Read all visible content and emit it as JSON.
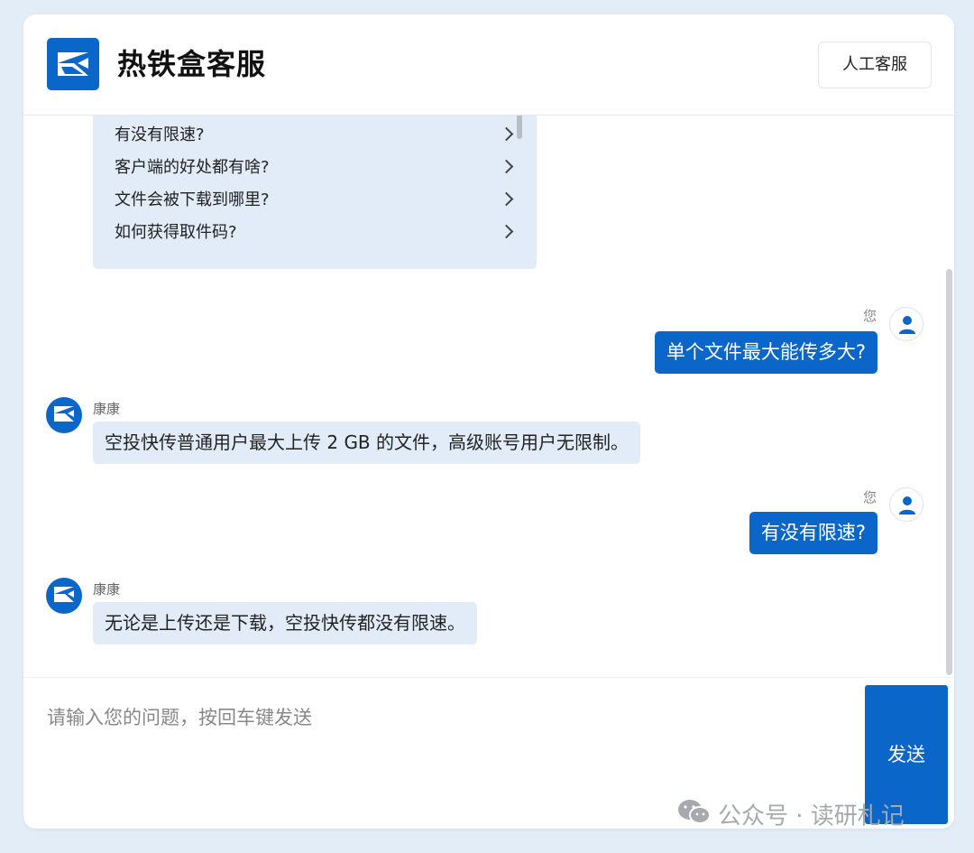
{
  "header": {
    "title": "热铁盒客服",
    "human_service_label": "人工客服"
  },
  "faq": {
    "items": [
      "有没有限速?",
      "客户端的好处都有啥?",
      "文件会被下载到哪里?",
      "如何获得取件码?"
    ]
  },
  "messages": [
    {
      "role": "user",
      "sender": "您",
      "text": "单个文件最大能传多大?"
    },
    {
      "role": "bot",
      "sender": "康康",
      "text": "空投快传普通用户最大上传 2 GB 的文件，高级账号用户无限制。"
    },
    {
      "role": "user",
      "sender": "您",
      "text": "有没有限速?"
    },
    {
      "role": "bot",
      "sender": "康康",
      "text": "无论是上传还是下载，空投快传都没有限速。"
    }
  ],
  "input": {
    "placeholder": "请输入您的问题，按回车键发送",
    "value": ""
  },
  "send_label": "发送",
  "watermark": "公众号 · 读研札记",
  "colors": {
    "accent": "#0a67c9",
    "bot_bubble": "#e1ecf8",
    "page_bg": "#e2edf8"
  },
  "icons": {
    "logo": "box-logo-icon",
    "user_avatar": "user-icon",
    "bot_avatar": "bot-logo-icon",
    "faq_arrow": "chevron-right-icon"
  }
}
